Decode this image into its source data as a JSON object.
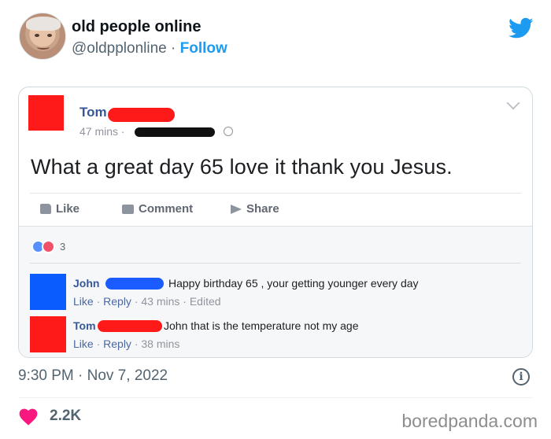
{
  "tweet": {
    "display_name": "old people online",
    "handle": "@oldpplonline",
    "separator": " · ",
    "follow_label": "Follow",
    "timestamp": "9:30 PM · Nov 7, 2022",
    "like_count": "2.2K",
    "info_glyph": "i"
  },
  "post": {
    "author": "Tom",
    "time": "47 mins ·",
    "text": "What a great day 65 love it thank you Jesus.",
    "actions": {
      "like": "Like",
      "comment": "Comment",
      "share": "Share"
    },
    "reaction_count": "3"
  },
  "comments": [
    {
      "author": "John",
      "text": "Happy birthday 65 , your getting younger every day",
      "reply_link_like": "Like",
      "reply_link_reply": "Reply",
      "meta": " · 43 mins · Edited",
      "avatar_color": "#0a5cff",
      "redact_color": "#1a5cff"
    },
    {
      "author": "Tom",
      "text": "John that is the temperature not my age",
      "reply_link_like": "Like",
      "reply_link_reply": "Reply",
      "meta": " · 38 mins",
      "avatar_color": "#ff1a1a",
      "redact_color": "#ff1a1a"
    }
  ],
  "watermark": "boredpanda.com",
  "colors": {
    "twitter_blue": "#1d9bf0",
    "fb_link": "#365899",
    "heart": "#f91880"
  },
  "icons": [
    "twitter-bird-icon",
    "globe-icon",
    "chevron-down-icon",
    "like-icon",
    "comment-icon",
    "share-icon",
    "info-icon",
    "heart-icon"
  ]
}
